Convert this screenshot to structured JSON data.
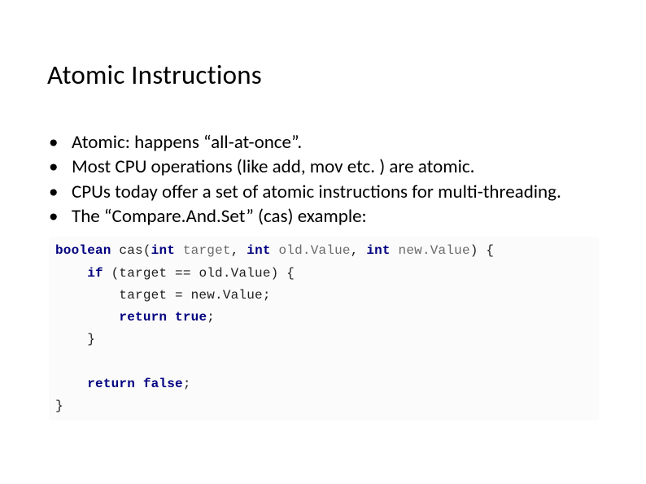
{
  "title": "Atomic Instructions",
  "bullets": [
    "Atomic: happens “all-at-once”.",
    "Most CPU operations (like add, mov etc. ) are atomic.",
    "CPUs today offer a set of atomic instructions for multi-threading.",
    "The “Compare.And.Set” (cas) example:"
  ],
  "code": {
    "l1_kw": "boolean",
    "l1_name": " cas",
    "l1_p1a": "(",
    "l1_t1": "int",
    "l1_prm1": " target",
    "l1_c1": ", ",
    "l1_t2": "int",
    "l1_prm2": " old.Value",
    "l1_c2": ", ",
    "l1_t3": "int",
    "l1_prm3": " new.Value",
    "l1_end": ") {",
    "l2_indent": "    ",
    "l2_kw": "if",
    "l2_body": " (target == old.Value) {",
    "l3": "        target = new.Value;",
    "l4_indent": "        ",
    "l4_kw": "return",
    "l4_val": " true",
    "l4_semi": ";",
    "l5": "    }",
    "l6": "",
    "l7_indent": "    ",
    "l7_kw": "return",
    "l7_val": " false",
    "l7_semi": ";",
    "l8": "}"
  }
}
